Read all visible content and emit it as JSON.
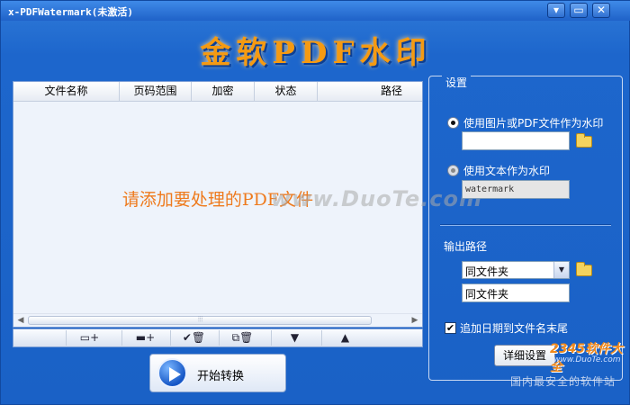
{
  "window": {
    "title": "x-PDFWatermark(未激活)",
    "minimize_glyph": "▾",
    "restore_glyph": "▭",
    "close_glyph": "✕"
  },
  "banner": {
    "text": "金软PDF水印"
  },
  "file_table": {
    "columns": [
      "文件名称",
      "页码范围",
      "加密",
      "状态",
      "路径"
    ],
    "empty_hint": "请添加要处理的PDF文件",
    "watermark_overlay": "www.DuoTe.com"
  },
  "scrollbar": {
    "left_arrow": "◀",
    "right_arrow": "▶",
    "grip": "⦙⦙⦙"
  },
  "toolbar": {
    "tools": [
      {
        "name": "add-file",
        "glyph": "▭+"
      },
      {
        "name": "add-folder",
        "glyph": "▬+"
      },
      {
        "name": "delete-checked",
        "glyph": "✔🗑"
      },
      {
        "name": "delete-all",
        "glyph": "⧉🗑"
      },
      {
        "name": "move-down",
        "glyph": "▼"
      },
      {
        "name": "move-up",
        "glyph": "▲"
      }
    ]
  },
  "start_button": {
    "label": "开始转换"
  },
  "settings": {
    "legend": "设置",
    "image_option": {
      "label": "使用图片或PDF文件作为水印",
      "selected": true,
      "value": ""
    },
    "text_option": {
      "label": "使用文本作为水印",
      "selected": false,
      "value": "watermark"
    },
    "output": {
      "label": "输出路径",
      "selected": "同文件夹",
      "path_value": "同文件夹"
    },
    "append_date": {
      "label": "追加日期到文件名末尾",
      "checked": true,
      "mark": "✔"
    },
    "detail_button": "详细设置"
  },
  "corner": {
    "logo": "2345软件大全",
    "logo_url": "www.DuoTe.com",
    "slogan": "国内最安全的软件站"
  },
  "colors": {
    "accent": "#1d66cc",
    "banner": "#f59a12",
    "hint": "#ee7a1d"
  }
}
